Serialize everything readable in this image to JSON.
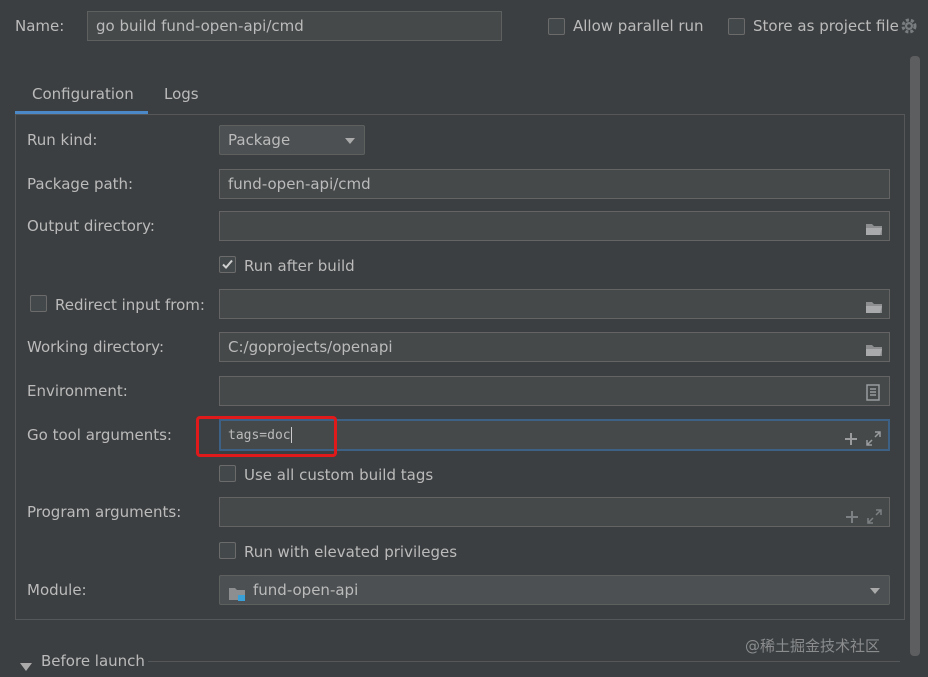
{
  "header": {
    "name_label": "Name:",
    "name_value": "go build fund-open-api/cmd",
    "allow_parallel_label": "Allow parallel run",
    "allow_parallel_checked": false,
    "store_project_label": "Store as project file",
    "store_project_checked": false
  },
  "tabs": [
    {
      "label": "Configuration",
      "active": true
    },
    {
      "label": "Logs",
      "active": false
    }
  ],
  "form": {
    "run_kind_label": "Run kind:",
    "run_kind_value": "Package",
    "package_path_label": "Package path:",
    "package_path_value": "fund-open-api/cmd",
    "output_directory_label": "Output directory:",
    "output_directory_value": "",
    "run_after_build_label": "Run after build",
    "run_after_build_checked": true,
    "redirect_input_label": "Redirect input from:",
    "redirect_input_checked": false,
    "redirect_input_value": "",
    "working_directory_label": "Working directory:",
    "working_directory_value": "C:/goprojects/openapi",
    "environment_label": "Environment:",
    "environment_value": "",
    "go_tool_args_label": "Go tool arguments:",
    "go_tool_args_value": "tags=doc",
    "use_custom_tags_label": "Use all custom build tags",
    "use_custom_tags_checked": false,
    "program_args_label": "Program arguments:",
    "program_args_value": "",
    "elevated_label": "Run with elevated privileges",
    "elevated_checked": false,
    "module_label": "Module:",
    "module_value": "fund-open-api"
  },
  "before_launch_label": "Before launch",
  "watermark": "@稀土掘金技术社区",
  "colors": {
    "background": "#3c3f41",
    "field": "#45494a",
    "accent": "#4a88c7",
    "highlight": "#e01a1a"
  }
}
